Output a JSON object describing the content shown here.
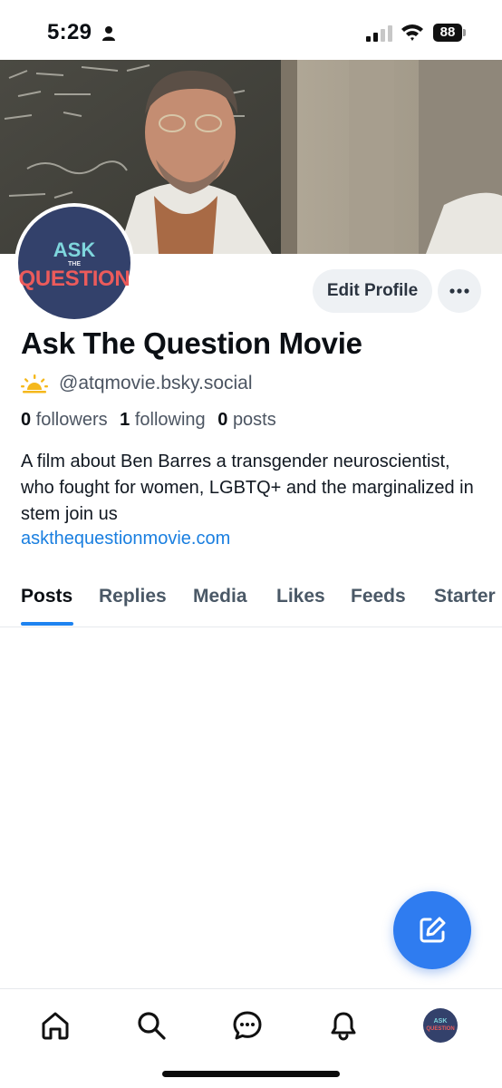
{
  "status_bar": {
    "time": "5:29",
    "battery": "88"
  },
  "avatar": {
    "line1": "ASK",
    "line2": "THE",
    "line3": "QUESTION"
  },
  "profile": {
    "display_name": "Ask The Question Movie",
    "handle": "@atqmovie.bsky.social",
    "edit_profile_label": "Edit Profile",
    "stats": {
      "followers_count": "0",
      "followers_label": "followers",
      "following_count": "1",
      "following_label": "following",
      "posts_count": "0",
      "posts_label": "posts"
    },
    "bio": "A film about Ben Barres a transgender neuroscientist, who fought for women, LGBTQ+ and the marginalized in stem join us",
    "link": "askthequestionmovie.com"
  },
  "tabs": [
    {
      "label": "Posts",
      "active": true
    },
    {
      "label": "Replies",
      "active": false
    },
    {
      "label": "Media",
      "active": false
    },
    {
      "label": "Likes",
      "active": false
    },
    {
      "label": "Feeds",
      "active": false
    },
    {
      "label": "Starter",
      "active": false
    }
  ],
  "bottom_nav": {
    "items": [
      "home-icon",
      "search-icon",
      "chat-icon",
      "bell-icon",
      "profile-avatar"
    ],
    "avatar_line1": "ASK",
    "avatar_line2": "QUESTION"
  },
  "colors": {
    "accent": "#1e83f0",
    "fab": "#2f7cf0",
    "link": "#1a7fe0",
    "avatar_bg": "#33416b"
  }
}
